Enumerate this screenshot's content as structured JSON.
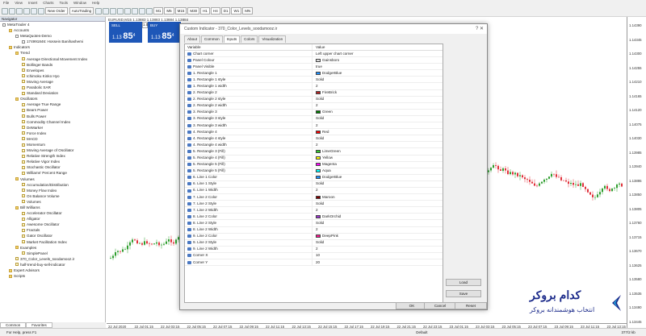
{
  "menu": [
    "File",
    "View",
    "Insert",
    "Charts",
    "Tools",
    "Window",
    "Help"
  ],
  "toolbar": {
    "new_order": "New Order",
    "auto_trading": "AutoTrading",
    "timeframes": [
      "M1",
      "M5",
      "M15",
      "M30",
      "H1",
      "H4",
      "D1",
      "W1",
      "MN"
    ]
  },
  "navigator": {
    "title": "Navigator",
    "tree": [
      {
        "level": 0,
        "icon": "e",
        "label": "MetaTrader 4"
      },
      {
        "level": 1,
        "icon": "f",
        "label": "Accounts"
      },
      {
        "level": 2,
        "icon": "e",
        "label": "MetaQuotes-Demo"
      },
      {
        "level": 3,
        "icon": "e",
        "label": "174991846: Hossein Banihashemi"
      },
      {
        "level": 1,
        "icon": "f",
        "label": "Indicators"
      },
      {
        "level": 2,
        "icon": "f",
        "label": "Trend"
      },
      {
        "level": 3,
        "icon": "i",
        "label": "Average Directional Movement Index"
      },
      {
        "level": 3,
        "icon": "i",
        "label": "Bollinger Bands"
      },
      {
        "level": 3,
        "icon": "i",
        "label": "Envelopes"
      },
      {
        "level": 3,
        "icon": "i",
        "label": "Ichimoku Kinko Hyo"
      },
      {
        "level": 3,
        "icon": "i",
        "label": "Moving Average"
      },
      {
        "level": 3,
        "icon": "i",
        "label": "Parabolic SAR"
      },
      {
        "level": 3,
        "icon": "i",
        "label": "Standard Deviation"
      },
      {
        "level": 2,
        "icon": "f",
        "label": "Oscillators"
      },
      {
        "level": 3,
        "icon": "i",
        "label": "Average True Range"
      },
      {
        "level": 3,
        "icon": "i",
        "label": "Bears Power"
      },
      {
        "level": 3,
        "icon": "i",
        "label": "Bulls Power"
      },
      {
        "level": 3,
        "icon": "i",
        "label": "Commodity Channel Index"
      },
      {
        "level": 3,
        "icon": "i",
        "label": "DeMarker"
      },
      {
        "level": 3,
        "icon": "i",
        "label": "Force Index"
      },
      {
        "level": 3,
        "icon": "i",
        "label": "MACD"
      },
      {
        "level": 3,
        "icon": "i",
        "label": "Momentum"
      },
      {
        "level": 3,
        "icon": "i",
        "label": "Moving Average of Oscillator"
      },
      {
        "level": 3,
        "icon": "i",
        "label": "Relative Strength Index"
      },
      {
        "level": 3,
        "icon": "i",
        "label": "Relative Vigor Index"
      },
      {
        "level": 3,
        "icon": "i",
        "label": "Stochastic Oscillator"
      },
      {
        "level": 3,
        "icon": "i",
        "label": "Williams' Percent Range"
      },
      {
        "level": 2,
        "icon": "f",
        "label": "Volumes"
      },
      {
        "level": 3,
        "icon": "i",
        "label": "Accumulation/Distribution"
      },
      {
        "level": 3,
        "icon": "i",
        "label": "Money Flow Index"
      },
      {
        "level": 3,
        "icon": "i",
        "label": "On Balance Volume"
      },
      {
        "level": 3,
        "icon": "i",
        "label": "Volumes"
      },
      {
        "level": 2,
        "icon": "f",
        "label": "Bill Williams"
      },
      {
        "level": 3,
        "icon": "i",
        "label": "Accelerator Oscillator"
      },
      {
        "level": 3,
        "icon": "i",
        "label": "Alligator"
      },
      {
        "level": 3,
        "icon": "i",
        "label": "Awesome Oscillator"
      },
      {
        "level": 3,
        "icon": "i",
        "label": "Fractals"
      },
      {
        "level": 3,
        "icon": "i",
        "label": "Gator Oscillator"
      },
      {
        "level": 3,
        "icon": "i",
        "label": "Market Facilitation Index"
      },
      {
        "level": 2,
        "icon": "f",
        "label": "Examples"
      },
      {
        "level": 3,
        "icon": "i",
        "label": "SimplePanel"
      },
      {
        "level": 2,
        "icon": "i",
        "label": "370_Color_Levels_soodamooz.ir"
      },
      {
        "level": 2,
        "icon": "i",
        "label": "half-trend-buy-sell-indicator"
      },
      {
        "level": 1,
        "icon": "f",
        "label": "Expert Advisors"
      },
      {
        "level": 1,
        "icon": "f",
        "label": "Scripts"
      }
    ],
    "tabs": [
      "Common",
      "Favorites"
    ]
  },
  "chart": {
    "symbol_line": "EURUSD,M15  1.13883  1.13883  1.13884  1.13884",
    "sell_label": "SELL",
    "buy_label": "BUY",
    "lot": "1.00",
    "sell_price_small": "1.13",
    "sell_price_big": "85",
    "sell_price_sup": "4",
    "buy_price_small": "1.13",
    "buy_price_big": "85",
    "buy_price_sup": "4",
    "price_axis": [
      "1.14390",
      "1.14345",
      "1.14300",
      "1.14255",
      "1.14210",
      "1.14165",
      "1.14120",
      "1.14075",
      "1.14030",
      "1.13985",
      "1.13940",
      "1.13895",
      "1.13850",
      "1.13805",
      "1.13760",
      "1.13715",
      "1.13670",
      "1.13625",
      "1.13580",
      "1.13535",
      "1.13490",
      "1.13445"
    ],
    "time_axis": [
      "22 Jul 2020",
      "22 Jul 01:15",
      "22 Jul 03:15",
      "22 Jul 05:15",
      "22 Jul 07:15",
      "22 Jul 09:15",
      "22 Jul 11:15",
      "22 Jul 13:15",
      "22 Jul 15:15",
      "22 Jul 17:15",
      "22 Jul 19:15",
      "22 Jul 21:15",
      "22 Jul 23:15",
      "23 Jul 01:15",
      "23 Jul 03:15",
      "23 Jul 05:15",
      "23 Jul 07:15",
      "23 Jul 09:15",
      "23 Jul 11:15",
      "23 Jul 13:15"
    ]
  },
  "dialog": {
    "title": "Custom Indicator - 370_Color_Levels_soodamooz.ir",
    "controls": "?   ✕",
    "tabs": [
      "About",
      "Common",
      "Inputs",
      "Colors",
      "Visualization"
    ],
    "active_tab": "Inputs",
    "header": {
      "variable": "Variable",
      "value": "Value"
    },
    "rows": [
      {
        "v": "Chart corner",
        "val": "Left upper chart corner"
      },
      {
        "v": "Panel Colour",
        "val": "Gainsboro",
        "c": "#dcdcdc"
      },
      {
        "v": "Panel Visible",
        "val": "true"
      },
      {
        "v": "1. Rectangle 1",
        "val": "DodgerBlue",
        "c": "#1e90ff"
      },
      {
        "v": "1. Rectangle 1 style",
        "val": "Solid"
      },
      {
        "v": "1. Rectangle 1 width",
        "val": "2"
      },
      {
        "v": "2. Rectangle 2",
        "val": "FireBrick",
        "c": "#b22222"
      },
      {
        "v": "2. Rectangle 2 style",
        "val": "Solid"
      },
      {
        "v": "2. Rectangle 2 width",
        "val": "2"
      },
      {
        "v": "3. Rectangle 3",
        "val": "Green",
        "c": "#008000"
      },
      {
        "v": "3. Rectangle 3 style",
        "val": "Solid"
      },
      {
        "v": "3. Rectangle 3 width",
        "val": "2"
      },
      {
        "v": "4. Rectangle 4",
        "val": "Red",
        "c": "#ff0000"
      },
      {
        "v": "4. Rectangle 4 style",
        "val": "Solid"
      },
      {
        "v": "4. Rectangle 4 width",
        "val": "2"
      },
      {
        "v": "5. Rectangle 3 (Fill)",
        "val": "LimeGreen",
        "c": "#32cd32"
      },
      {
        "v": "5. Rectangle 4 (Fill)",
        "val": "Yellow",
        "c": "#ffff00"
      },
      {
        "v": "5. Rectangle 5 (Fill)",
        "val": "Magenta",
        "c": "#ff00ff"
      },
      {
        "v": "5. Rectangle 5 (Fill)",
        "val": "Aqua",
        "c": "#00ffff"
      },
      {
        "v": "6. Line 1 Color",
        "val": "DodgerBlue",
        "c": "#1e90ff"
      },
      {
        "v": "6. Line 1 Style",
        "val": "Solid"
      },
      {
        "v": "6. Line 1 Width",
        "val": "2"
      },
      {
        "v": "7. Line 2 Color",
        "val": "Maroon",
        "c": "#800000"
      },
      {
        "v": "7. Line 2 Style",
        "val": "Solid"
      },
      {
        "v": "7. Line 2 Width",
        "val": "2"
      },
      {
        "v": "8. Line 2 Color",
        "val": "DarkOrchid",
        "c": "#9932cc"
      },
      {
        "v": "8. Line 2 Style",
        "val": "Solid"
      },
      {
        "v": "8. Line 2 Width",
        "val": "2"
      },
      {
        "v": "9. Line 2 Color",
        "val": "DeepPink",
        "c": "#ff1493"
      },
      {
        "v": "9. Line 2 Style",
        "val": "Solid"
      },
      {
        "v": "9. Line 2 Width",
        "val": "2"
      },
      {
        "v": "Corner X",
        "val": "10"
      },
      {
        "v": "Corner Y",
        "val": "20"
      }
    ],
    "load": "Load",
    "save": "Save",
    "ok": "OK",
    "cancel": "Cancel",
    "reset": "Reset"
  },
  "brand": {
    "name": "کدام بروکر",
    "tagline": "انتخاب هوشمندانه بروکر",
    "color": "#1b2a8a"
  },
  "status": {
    "help": "For Help, press F1",
    "profile": "Default",
    "connection": "377/2 kb"
  }
}
